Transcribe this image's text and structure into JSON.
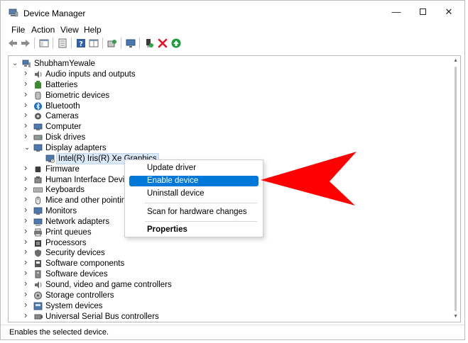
{
  "window": {
    "title": "Device Manager",
    "controls": {
      "minimize": "—",
      "close": "✕"
    }
  },
  "menu": [
    "File",
    "Action",
    "View",
    "Help"
  ],
  "tree": {
    "root": "ShubhamYewale",
    "categories": [
      {
        "label": "Audio inputs and outputs",
        "icon": "speaker-icon"
      },
      {
        "label": "Batteries",
        "icon": "battery-icon"
      },
      {
        "label": "Biometric devices",
        "icon": "biometric-icon"
      },
      {
        "label": "Bluetooth",
        "icon": "bluetooth-icon"
      },
      {
        "label": "Cameras",
        "icon": "camera-icon"
      },
      {
        "label": "Computer",
        "icon": "computer-icon"
      },
      {
        "label": "Disk drives",
        "icon": "disk-icon"
      },
      {
        "label": "Display adapters",
        "icon": "monitor-icon",
        "expanded": true
      },
      {
        "label": "Firmware",
        "icon": "chip-icon"
      },
      {
        "label": "Human Interface Devices",
        "icon": "hid-icon"
      },
      {
        "label": "Keyboards",
        "icon": "keyboard-icon"
      },
      {
        "label": "Mice and other pointing devices",
        "icon": "mouse-icon"
      },
      {
        "label": "Monitors",
        "icon": "monitor-icon"
      },
      {
        "label": "Network adapters",
        "icon": "network-icon"
      },
      {
        "label": "Print queues",
        "icon": "printer-icon"
      },
      {
        "label": "Processors",
        "icon": "processor-icon"
      },
      {
        "label": "Security devices",
        "icon": "security-icon"
      },
      {
        "label": "Software components",
        "icon": "component-icon"
      },
      {
        "label": "Software devices",
        "icon": "software-device-icon"
      },
      {
        "label": "Sound, video and game controllers",
        "icon": "speaker-icon"
      },
      {
        "label": "Storage controllers",
        "icon": "storage-icon"
      },
      {
        "label": "System devices",
        "icon": "system-icon"
      },
      {
        "label": "Universal Serial Bus controllers",
        "icon": "usb-icon"
      }
    ],
    "display_child": "Intel(R) Iris(R) Xe Graphics"
  },
  "context_menu": {
    "items": [
      "Update driver",
      "Enable device",
      "Uninstall device",
      "Scan for hardware changes",
      "Properties"
    ],
    "highlighted": "Enable device"
  },
  "status": "Enables the selected device.",
  "colors": {
    "accent": "#0078d7",
    "arrow": "#ff0000",
    "remove": "#e81123",
    "enable": "#1a9c3a"
  }
}
